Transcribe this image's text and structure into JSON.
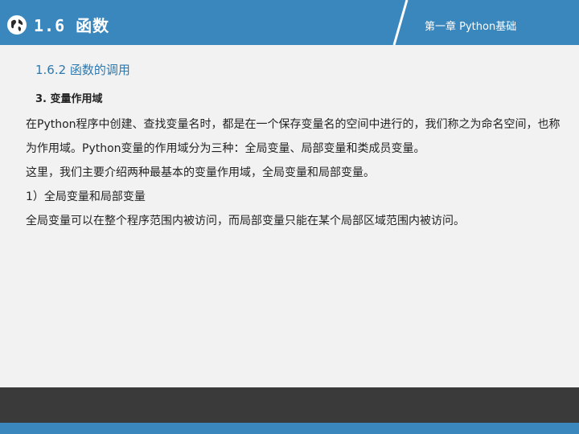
{
  "header": {
    "section_title": "1.6  函数",
    "chapter_label": "第一章 Python基础",
    "colors": {
      "primary": "#3a87bd",
      "footer": "#3a3a3a"
    }
  },
  "content": {
    "subsection": "1.6.2  函数的调用",
    "topic": "3. 变量作用域",
    "paragraphs": [
      "在Python程序中创建、查找变量名时，都是在一个保存变量名的空间中进行的，我们称之为命名空间，也称为作用域。Python变量的作用域分为三种：全局变量、局部变量和类成员变量。",
      "这里，我们主要介绍两种最基本的变量作用域，全局变量和局部变量。",
      "1）全局变量和局部变量",
      "全局变量可以在整个程序范围内被访问，而局部变量只能在某个局部区域范围内被访问。"
    ]
  }
}
